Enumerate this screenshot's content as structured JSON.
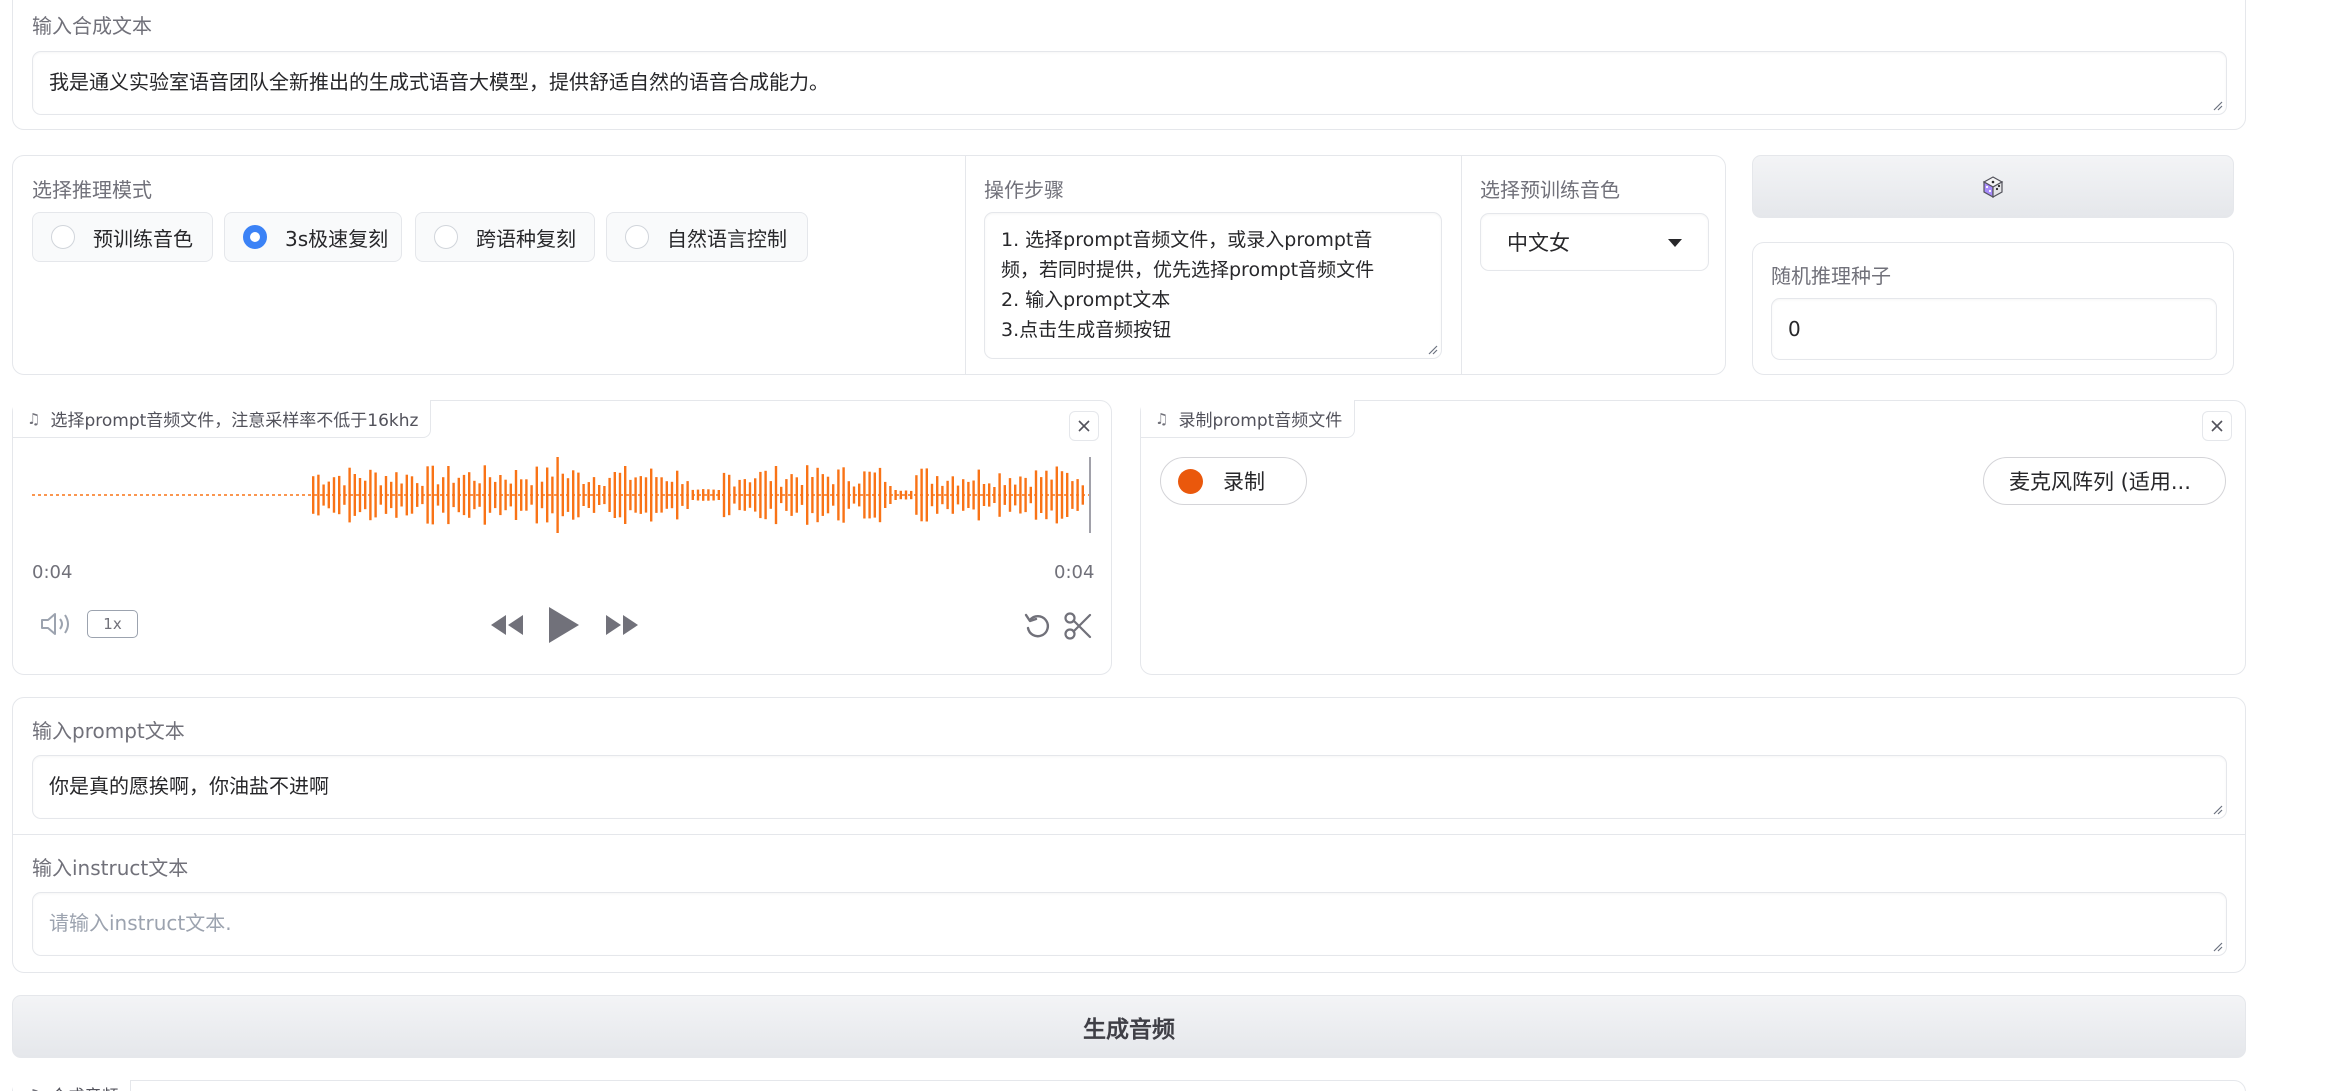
{
  "tts_input": {
    "label": "输入合成文本",
    "value": "我是通义实验室语音团队全新推出的生成式语音大模型，提供舒适自然的语音合成能力。"
  },
  "mode": {
    "label": "选择推理模式",
    "options": [
      "预训练音色",
      "3s极速复刻",
      "跨语种复刻",
      "自然语言控制"
    ],
    "selected": "3s极速复刻"
  },
  "steps": {
    "label": "操作步骤",
    "lines": [
      "1. 选择prompt音频文件，或录入prompt音",
      "频，若同时提供，优先选择prompt音频文件",
      "2. 输入prompt文本",
      "3.点击生成音频按钮"
    ]
  },
  "voice": {
    "label": "选择预训练音色",
    "value": "中文女"
  },
  "seed": {
    "dice_icon": "dice-icon",
    "label": "随机推理种子",
    "value": "0"
  },
  "prompt_audio": {
    "tab_label": "选择prompt音频文件，注意采样率不低于16khz",
    "time_current": "0:04",
    "time_total": "0:04",
    "speed": "1x"
  },
  "record": {
    "tab_label": "录制prompt音频文件",
    "record_label": "录制",
    "mic_label": "麦克风阵列 (适用..."
  },
  "prompt_text": {
    "label": "输入prompt文本",
    "value": "你是真的愿挨啊，你油盐不进啊"
  },
  "instruct_text": {
    "label": "输入instruct文本",
    "placeholder": "请输入instruct文本."
  },
  "generate": {
    "label": "生成音频"
  },
  "output_audio": {
    "tab_label": "合成音频"
  },
  "colors": {
    "accent": "#3b82f6",
    "waveform": "#f97316",
    "record": "#ea580c"
  }
}
